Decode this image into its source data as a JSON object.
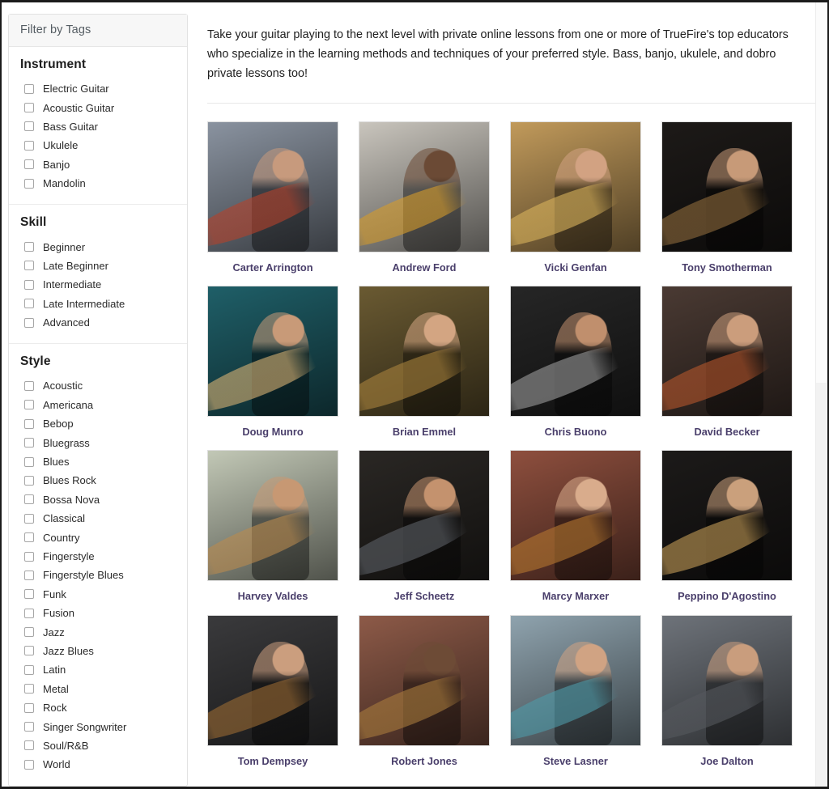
{
  "sidebar": {
    "header": "Filter by Tags",
    "sections": [
      {
        "title": "Instrument",
        "options": [
          "Electric Guitar",
          "Acoustic Guitar",
          "Bass Guitar",
          "Ukulele",
          "Banjo",
          "Mandolin"
        ]
      },
      {
        "title": "Skill",
        "options": [
          "Beginner",
          "Late Beginner",
          "Intermediate",
          "Late Intermediate",
          "Advanced"
        ]
      },
      {
        "title": "Style",
        "options": [
          "Acoustic",
          "Americana",
          "Bebop",
          "Bluegrass",
          "Blues",
          "Blues Rock",
          "Bossa Nova",
          "Classical",
          "Country",
          "Fingerstyle",
          "Fingerstyle Blues",
          "Funk",
          "Fusion",
          "Jazz",
          "Jazz Blues",
          "Latin",
          "Metal",
          "Rock",
          "Singer Songwriter",
          "Soul/R&B",
          "World"
        ]
      }
    ]
  },
  "main": {
    "intro": "Take your guitar playing to the next level with private online lessons from one or more of TrueFire's top educators who specialize in the learning methods and techniques of your preferred style. Bass, banjo, ukulele, and dobro private lessons too!",
    "instructors": [
      {
        "name": "Carter Arrington",
        "bg": "#8a93a0",
        "accent": "#b5412a",
        "skin": "#c79a7d"
      },
      {
        "name": "Andrew Ford",
        "bg": "#c9c5bd",
        "accent": "#d59b2a",
        "skin": "#6b4a35"
      },
      {
        "name": "Vicki Genfan",
        "bg": "#c19a5b",
        "accent": "#d9b35c",
        "skin": "#d2a282"
      },
      {
        "name": "Tony Smotherman",
        "bg": "#1d1a18",
        "accent": "#8f6b3c",
        "skin": "#c79a78"
      },
      {
        "name": "Doug Munro",
        "bg": "#1f5f68",
        "accent": "#d7b173",
        "skin": "#c89a78"
      },
      {
        "name": "Brian Emmel",
        "bg": "#6a5a32",
        "accent": "#a8823c",
        "skin": "#d3a582"
      },
      {
        "name": "Chris Buono",
        "bg": "#262626",
        "accent": "#9a9a9a",
        "skin": "#c08f6d"
      },
      {
        "name": "David Becker",
        "bg": "#4a3a33",
        "accent": "#b5562c",
        "skin": "#cb9d7c"
      },
      {
        "name": "Harvey Valdes",
        "bg": "#c2c8b6",
        "accent": "#b98a4e",
        "skin": "#c79873"
      },
      {
        "name": "Jeff Scheetz",
        "bg": "#2a2724",
        "accent": "#5c6066",
        "skin": "#c4926e"
      },
      {
        "name": "Marcy Marxer",
        "bg": "#8e4f3e",
        "accent": "#b4762f",
        "skin": "#d9ac8c"
      },
      {
        "name": "Peppino D'Agostino",
        "bg": "#1c1a19",
        "accent": "#c39b56",
        "skin": "#caa07c"
      },
      {
        "name": "Tom Dempsey",
        "bg": "#3a3a3c",
        "accent": "#9a6a33",
        "skin": "#cb9e7e"
      },
      {
        "name": "Robert Jones",
        "bg": "#8d5a48",
        "accent": "#a87b3c",
        "skin": "#6d4b36"
      },
      {
        "name": "Steve Lasner",
        "bg": "#8fa3ae",
        "accent": "#4e9aa8",
        "skin": "#d0a383"
      },
      {
        "name": "Joe Dalton",
        "bg": "#6e737a",
        "accent": "#55585d",
        "skin": "#c99d7d"
      }
    ]
  },
  "colors": {
    "link": "#4a3f6b",
    "panel_header_bg": "#f7f7f7",
    "border": "#e2e2e2"
  }
}
